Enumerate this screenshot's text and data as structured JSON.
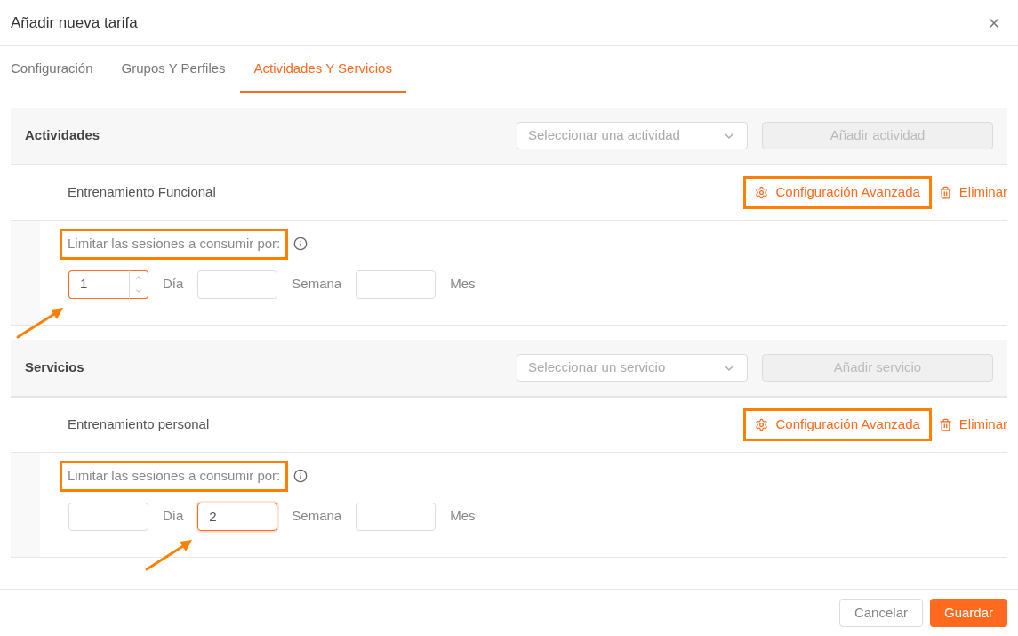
{
  "dialog": {
    "title": "Añadir nueva tarifa"
  },
  "tabs": [
    {
      "label": "Configuración",
      "selected": false
    },
    {
      "label": "Grupos Y Perfiles",
      "selected": false
    },
    {
      "label": "Actividades Y Servicios",
      "selected": true
    }
  ],
  "sections": [
    {
      "title": "Actividades",
      "select": {
        "placeholder": "Seleccionar una actividad"
      },
      "add_button": {
        "label": "Añadir actividad",
        "disabled": true
      },
      "item": {
        "name": "Entrenamiento Funcional",
        "config_button": {
          "label": "Configuración Avanzada",
          "highlighted": true
        },
        "delete_button": {
          "label": "Eliminar"
        },
        "limit": {
          "label": "Limitar las sesiones a consumir por:",
          "highlighted": true
        },
        "fields": [
          {
            "kind": "number",
            "value": "1",
            "unit": "Día",
            "focused": true
          },
          {
            "kind": "text",
            "unit": "Semana",
            "focused": false
          },
          {
            "kind": "text",
            "unit": "Mes",
            "focused": false
          }
        ]
      }
    },
    {
      "title": "Servicios",
      "select": {
        "placeholder": "Seleccionar un servicio"
      },
      "add_button": {
        "label": "Añadir servicio",
        "disabled": true
      },
      "item": {
        "name": "Entrenamiento personal",
        "config_button": {
          "label": "Configuración Avanzada",
          "highlighted": true
        },
        "delete_button": {
          "label": "Eliminar"
        },
        "limit": {
          "label": "Limitar las sesiones a consumir por:",
          "highlighted": true
        },
        "fields": [
          {
            "kind": "text",
            "unit": "Día",
            "focused": false
          },
          {
            "kind": "text",
            "value": "2",
            "unit": "Semana",
            "focused": true
          },
          {
            "kind": "text",
            "unit": "Mes",
            "focused": false
          }
        ]
      }
    }
  ],
  "footer": {
    "cancel": "Cancelar",
    "save": "Guardar"
  }
}
